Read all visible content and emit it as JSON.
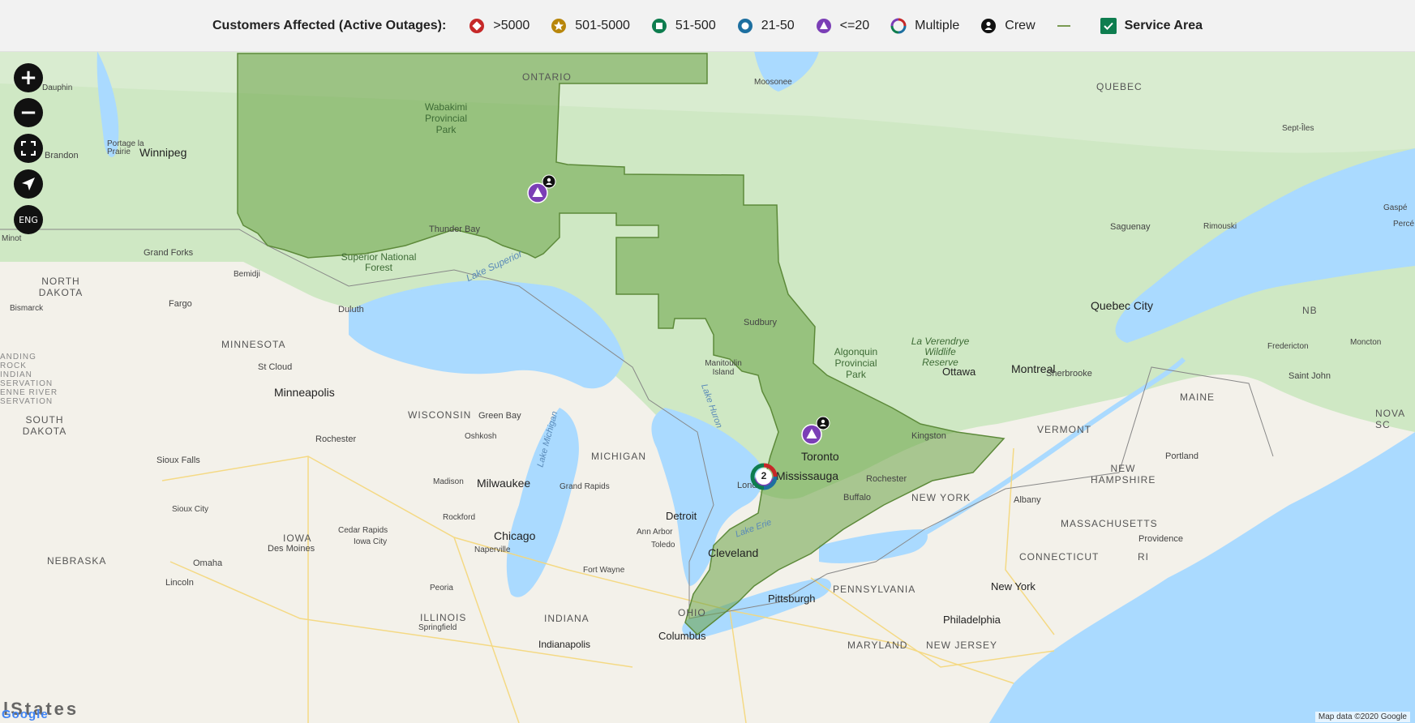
{
  "legend": {
    "title": "Customers Affected (Active Outages):",
    "items": [
      {
        "label": ">5000",
        "icon": "diamond-icon",
        "color": "#c62828"
      },
      {
        "label": "501-5000",
        "icon": "star-icon",
        "color": "#b8860b"
      },
      {
        "label": "51-500",
        "icon": "square-icon",
        "color": "#0e7d4f"
      },
      {
        "label": "21-50",
        "icon": "circle-icon",
        "color": "#1d6fa0"
      },
      {
        "label": "<=20",
        "icon": "triangle-icon",
        "color": "#7b3fb6"
      },
      {
        "label": "Multiple",
        "icon": "multiple-ring-icon",
        "color": "#888888"
      },
      {
        "label": "Crew",
        "icon": "crew-icon",
        "color": "#111111"
      }
    ],
    "service_area_label": "Service Area",
    "service_area_checked": true
  },
  "controls": {
    "zoom_in": "+",
    "zoom_out": "−",
    "fullscreen": "⛶",
    "locate": "➤",
    "language": "ENG"
  },
  "cluster_count": "2",
  "map_labels": {
    "ontario": "ONTARIO",
    "quebec": "QUEBEC",
    "wabakimi": "Wabakimi Provincial Park",
    "winnipeg": "Winnipeg",
    "brandon": "Brandon",
    "dauphin": "Dauphin",
    "portage": "Portage la Prairie",
    "moosonee": "Moosonee",
    "thunder_bay": "Thunder Bay",
    "superior_nf": "Superior National Forest",
    "lake_superior": "Lake Superior",
    "grand_forks": "Grand Forks",
    "north_dakota": "NORTH DAKOTA",
    "fargo": "Fargo",
    "bismarck": "Bismarck",
    "minot": "Minot",
    "bemidji": "Bemidji",
    "duluth": "Duluth",
    "minnesota": "MINNESOTA",
    "st_cloud": "St Cloud",
    "minneapolis": "Minneapolis",
    "south_dakota": "SOUTH DAKOTA",
    "wisconsin": "WISCONSIN",
    "green_bay": "Green Bay",
    "oshkosh": "Oshkosh",
    "rochester_mn": "Rochester",
    "sioux_falls": "Sioux Falls",
    "sioux_city": "Sioux City",
    "iowa": "IOWA",
    "des_moines": "Des Moines",
    "cedar_rapids": "Cedar Rapids",
    "iowa_city": "Iowa City",
    "nebraska": "NEBRASKA",
    "omaha": "Omaha",
    "lincoln": "Lincoln",
    "madison": "Madison",
    "milwaukee": "Milwaukee",
    "rockford": "Rockford",
    "chicago": "Chicago",
    "naperville": "Naperville",
    "peoria": "Peoria",
    "illinois": "ILLINOIS",
    "springfield": "Springfield",
    "indiana": "INDIANA",
    "indianapolis": "Indianapolis",
    "michigan": "MICHIGAN",
    "lake_michigan": "Lake Michigan",
    "grand_rapids": "Grand Rapids",
    "detroit": "Detroit",
    "ann_arbor": "Ann Arbor",
    "toledo": "Toledo",
    "fort_wayne": "Fort Wayne",
    "cleveland": "Cleveland",
    "ohio": "OHIO",
    "columbus": "Columbus",
    "pittsburgh": "Pittsburgh",
    "pennsylvania": "PENNSYLVANIA",
    "philadelphia": "Philadelphia",
    "maryland": "MARYLAND",
    "new_jersey": "NEW JERSEY",
    "new_york_state": "NEW YORK",
    "new_york_city": "New York",
    "sudbury": "Sudbury",
    "manitoulin": "Manitoulin Island",
    "lake_huron": "Lake Huron",
    "lake_erie": "Lake Erie",
    "algonquin": "Algonquin Provincial Park",
    "toronto": "Toronto",
    "mississauga": "Mississauga",
    "london": "London",
    "buffalo": "Buffalo",
    "rochester_ny": "Rochester",
    "kingston": "Kingston",
    "ottawa": "Ottawa",
    "montreal": "Montreal",
    "la_verendrye": "La Verendrye Wildlife Reserve",
    "quebec_city": "Quebec City",
    "saguenay": "Saguenay",
    "sept_iles": "Sept-Îles",
    "rimouski": "Rimouski",
    "gaspe": "Gaspé",
    "perce": "Percé",
    "sherbrooke": "Sherbrooke",
    "vermont": "VERMONT",
    "new_hampshire": "NEW HAMPSHIRE",
    "massachusetts": "MASSACHUSETTS",
    "albany": "Albany",
    "connecticut": "CONNECTICUT",
    "providence": "Providence",
    "ri": "RI",
    "portland": "Portland",
    "maine": "MAINE",
    "nova_scotia": "NOVA SC",
    "nb": "NB",
    "fredericton": "Fredericton",
    "moncton": "Moncton",
    "saint_john": "Saint John",
    "standing_rock": "ANDING ROCK INDIAN SERVATION",
    "cheyenne_river": "ENNE RIVER SERVATION"
  },
  "footer": {
    "google": "Google",
    "states": "lStates",
    "attribution": "Map data ©2020 Google"
  }
}
